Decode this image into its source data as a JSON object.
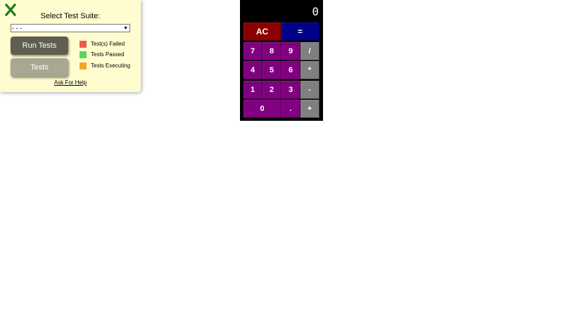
{
  "test_panel": {
    "close_icon": "close-x-icon",
    "close_color": "#1a7a1a",
    "title": "Select Test Suite:",
    "suite_select": {
      "selected": "- - -"
    },
    "run_tests_label": "Run Tests",
    "tests_label": "Tests",
    "legend": [
      {
        "label": "Test(s) Failed",
        "color": "#f05a4a"
      },
      {
        "label": "Tests Passed",
        "color": "#5cd65c"
      },
      {
        "label": "Tests Executing",
        "color": "#f5a623"
      }
    ],
    "help_link": "Ask For Help"
  },
  "calculator": {
    "display": "0",
    "keys": {
      "ac": "AC",
      "equals": "=",
      "seven": "7",
      "eight": "8",
      "nine": "9",
      "divide": "/",
      "four": "4",
      "five": "5",
      "six": "6",
      "multiply": "*",
      "one": "1",
      "two": "2",
      "three": "3",
      "subtract": "-",
      "zero": "0",
      "decimal": ".",
      "add": "+"
    },
    "colors": {
      "number_key": "#800080",
      "operator_key": "#808080",
      "clear_key": "#8b0000",
      "equals_key": "#00008b"
    }
  }
}
